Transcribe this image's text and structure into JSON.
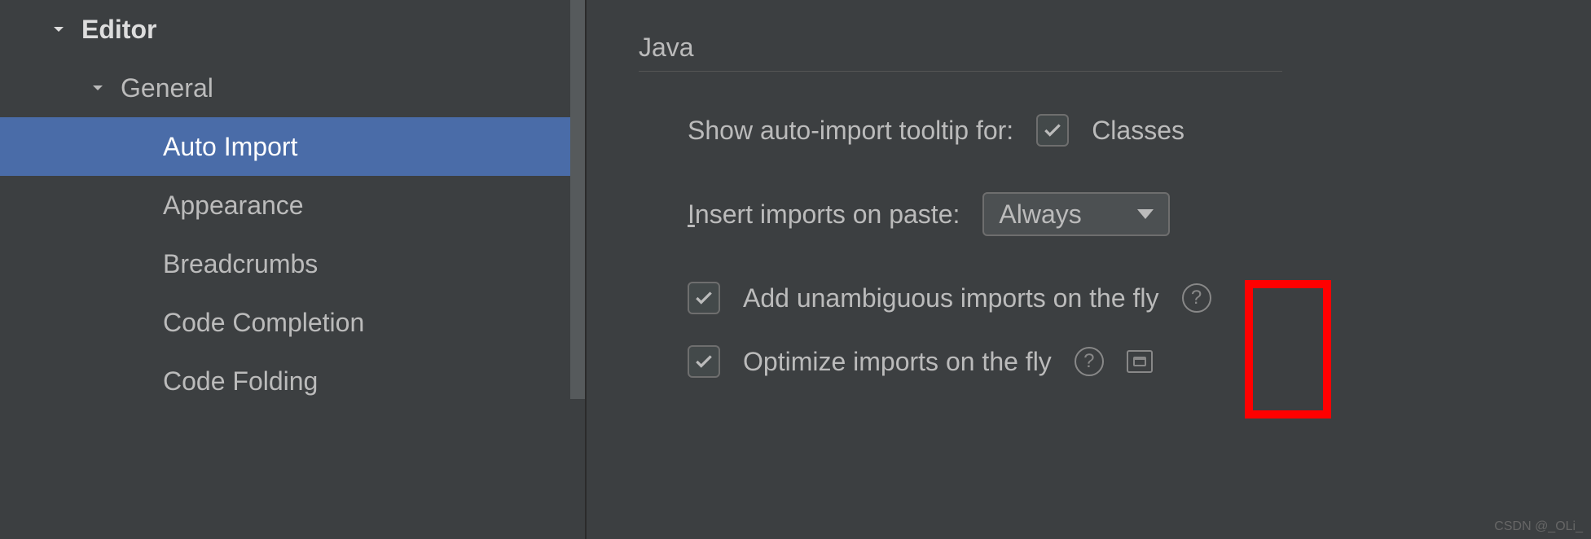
{
  "sidebar": {
    "items": [
      {
        "label": "Editor",
        "level": 0,
        "expanded": true
      },
      {
        "label": "General",
        "level": 1,
        "expanded": true
      },
      {
        "label": "Auto Import",
        "level": 2,
        "selected": true
      },
      {
        "label": "Appearance",
        "level": 2
      },
      {
        "label": "Breadcrumbs",
        "level": 2
      },
      {
        "label": "Code Completion",
        "level": 2
      },
      {
        "label": "Code Folding",
        "level": 2
      }
    ]
  },
  "content": {
    "section_title": "Java",
    "tooltip_label": "Show auto-import tooltip for:",
    "tooltip_classes_label": "Classes",
    "tooltip_classes_checked": true,
    "insert_label": "Insert imports on paste:",
    "insert_value": "Always",
    "add_unambiguous_label": "Add unambiguous imports on the fly",
    "add_unambiguous_checked": true,
    "optimize_label": "Optimize imports on the fly",
    "optimize_checked": true
  },
  "watermark": "CSDN @_OLi_"
}
